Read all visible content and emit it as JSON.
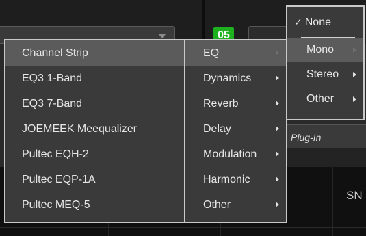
{
  "background": {
    "track_badge": "05",
    "insert_label": "Plug-In",
    "partial_text": "SN"
  },
  "menu_categories_type": {
    "items": [
      {
        "label": "None",
        "checked": true
      },
      {
        "label": "Mono"
      },
      {
        "label": "Stereo"
      },
      {
        "label": "Other"
      }
    ]
  },
  "menu_categories": {
    "items": [
      {
        "label": "EQ"
      },
      {
        "label": "Dynamics"
      },
      {
        "label": "Reverb"
      },
      {
        "label": "Delay"
      },
      {
        "label": "Modulation"
      },
      {
        "label": "Harmonic"
      },
      {
        "label": "Other"
      }
    ]
  },
  "menu_plugins": {
    "items": [
      {
        "label": "Channel Strip"
      },
      {
        "label": "EQ3 1-Band"
      },
      {
        "label": "EQ3 7-Band"
      },
      {
        "label": "JOEMEEK Meequalizer"
      },
      {
        "label": "Pultec EQH-2"
      },
      {
        "label": "Pultec EQP-1A"
      },
      {
        "label": "Pultec MEQ-5"
      }
    ]
  },
  "colors": {
    "highlight": "#5b5b5b",
    "menu_bg": "#3a3a3a",
    "badge_green": "#1fb01f"
  },
  "icons": [
    "check-icon",
    "submenu-arrow-icon",
    "dropdown-arrow-icon"
  ]
}
